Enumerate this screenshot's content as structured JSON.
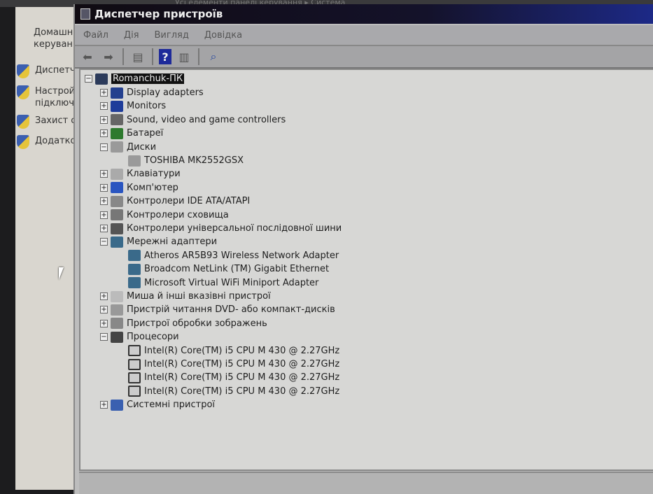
{
  "background": {
    "breadcrumb": "Усі елементи панелі керування ▸ Система",
    "left_panel": {
      "home": "Домашня керуванн",
      "items": [
        "Диспетч",
        "Настрой підключ",
        "Захист с",
        "Додатко"
      ]
    }
  },
  "window": {
    "title": "Диспетчер пристроїв",
    "menu": [
      "Файл",
      "Дія",
      "Вигляд",
      "Довідка"
    ],
    "toolbar": [
      "back",
      "forward",
      "show-hide-console-tree",
      "help",
      "properties",
      "scan-hardware"
    ]
  },
  "tree": {
    "root": "Romanchuk-ПК",
    "nodes": [
      {
        "label": "Display adapters",
        "expanded": false,
        "icon": "display-adapter"
      },
      {
        "label": "Monitors",
        "expanded": false,
        "icon": "monitor"
      },
      {
        "label": "Sound, video and game controllers",
        "expanded": false,
        "icon": "speaker"
      },
      {
        "label": "Батареї",
        "expanded": false,
        "icon": "battery"
      },
      {
        "label": "Диски",
        "expanded": true,
        "icon": "disk",
        "children": [
          "TOSHIBA MK2552GSX"
        ]
      },
      {
        "label": "Клавіатури",
        "expanded": false,
        "icon": "keyboard"
      },
      {
        "label": "Комп'ютер",
        "expanded": false,
        "icon": "computer"
      },
      {
        "label": "Контролери IDE ATA/ATAPI",
        "expanded": false,
        "icon": "ide"
      },
      {
        "label": "Контролери сховища",
        "expanded": false,
        "icon": "storage"
      },
      {
        "label": "Контролери універсальної послідовної шини",
        "expanded": false,
        "icon": "usb"
      },
      {
        "label": "Мережні адаптери",
        "expanded": true,
        "icon": "network",
        "children": [
          "Atheros AR5B93 Wireless Network Adapter",
          "Broadcom NetLink (TM) Gigabit Ethernet",
          "Microsoft Virtual WiFi Miniport Adapter"
        ]
      },
      {
        "label": "Миша й інші вказівні пристрої",
        "expanded": false,
        "icon": "mouse"
      },
      {
        "label": "Пристрій читання DVD- або компакт-дисків",
        "expanded": false,
        "icon": "dvd"
      },
      {
        "label": "Пристрої обробки зображень",
        "expanded": false,
        "icon": "camera"
      },
      {
        "label": "Процесори",
        "expanded": true,
        "icon": "cpu",
        "children": [
          "Intel(R) Core(TM) i5 CPU M 430 @ 2.27GHz",
          "Intel(R) Core(TM) i5 CPU M 430 @ 2.27GHz",
          "Intel(R) Core(TM) i5 CPU M 430 @ 2.27GHz",
          "Intel(R) Core(TM) i5 CPU M 430 @ 2.27GHz"
        ]
      },
      {
        "label": "Системні пристрої",
        "expanded": false,
        "icon": "system"
      }
    ]
  }
}
